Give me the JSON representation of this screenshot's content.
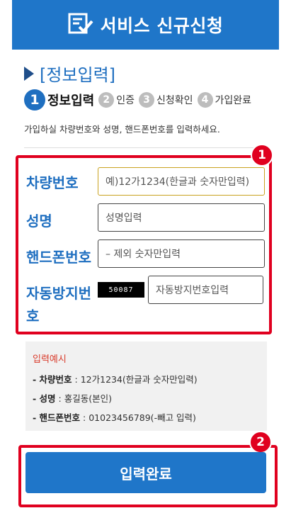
{
  "header": {
    "title": "서비스 신규신청",
    "icon": "form-check-icon"
  },
  "section": {
    "title": "[정보입력]"
  },
  "steps": [
    {
      "num": "1",
      "label": "정보입력"
    },
    {
      "num": "2",
      "label": "인증"
    },
    {
      "num": "3",
      "label": "신청확인"
    },
    {
      "num": "4",
      "label": "가입완료"
    }
  ],
  "description": "가입하실 차량번호와 성명, 핸드폰번호를 입력하세요.",
  "badges": {
    "first": "1",
    "second": "2"
  },
  "form": {
    "car_number": {
      "label": "차량번호",
      "placeholder": "예)12가1234(한글과 숫자만입력)"
    },
    "name": {
      "label": "성명",
      "placeholder": "성명입력"
    },
    "phone": {
      "label": "핸드폰번호",
      "placeholder": "– 제외 숫자만입력"
    },
    "captcha": {
      "label": "자동방지번호",
      "image_text": "50087",
      "placeholder": "자동방지번호입력"
    }
  },
  "example": {
    "title": "입력예시",
    "lines": [
      {
        "key": "- 차량번호",
        "value": " : 12가1234(한글과 숫자만입력)"
      },
      {
        "key": "- 성명",
        "value": " : 홍길동(본인)"
      },
      {
        "key": "- 핸드폰번호",
        "value": " : 01023456789(-빼고 입력)"
      }
    ]
  },
  "submit": {
    "label": "입력완료"
  },
  "colors": {
    "primary": "#1f76c9",
    "highlight": "#e0001f",
    "example_title": "#d93b2b"
  }
}
